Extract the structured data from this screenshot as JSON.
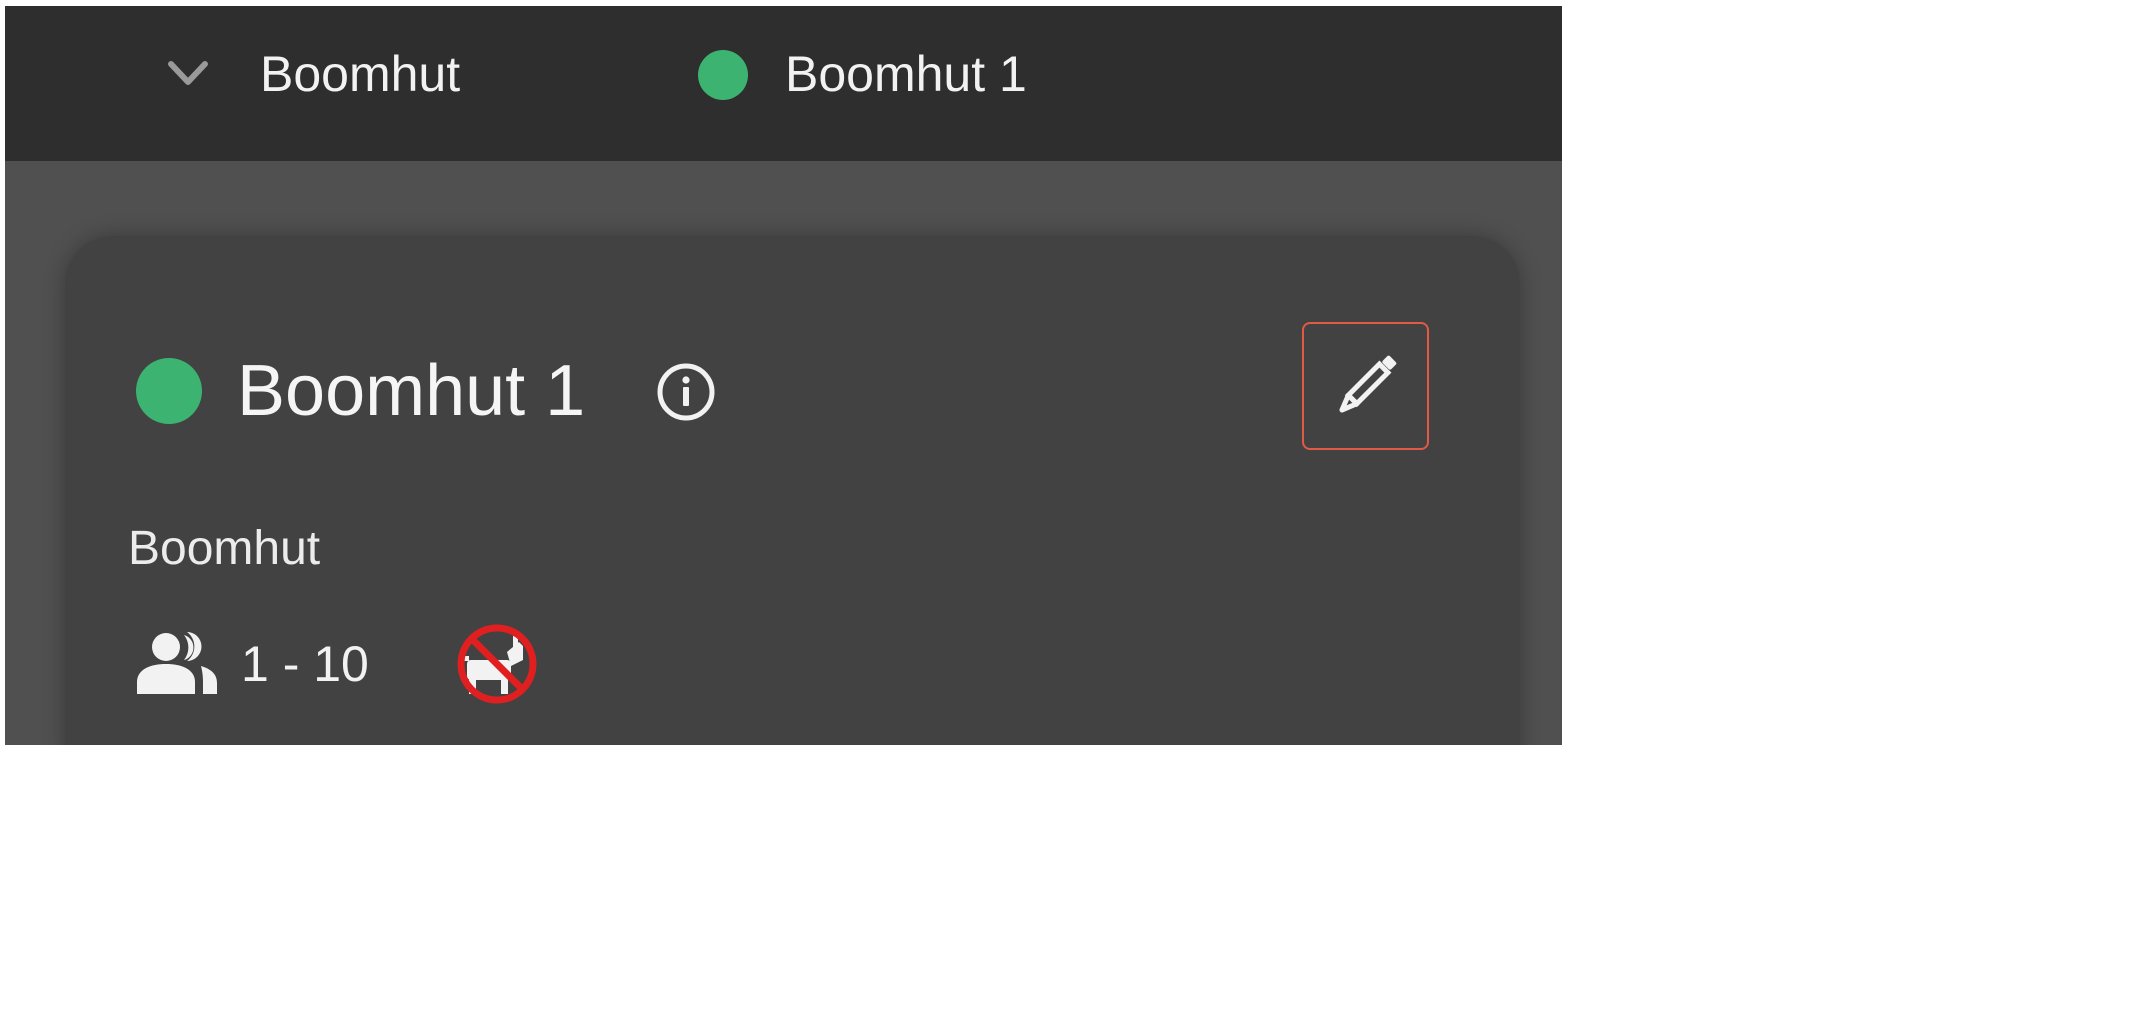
{
  "breadcrumb": {
    "parent_label": "Boomhut",
    "current_label": "Boomhut 1",
    "status_color": "#3cb371"
  },
  "card": {
    "title": "Boomhut 1",
    "status_color": "#3cb371",
    "type_label": "Boomhut",
    "capacity": "1 - 10",
    "icons": {
      "info": "info-circle-icon",
      "edit": "pencil-icon",
      "people": "people-icon",
      "no_pets": "no-pets-icon"
    },
    "accent_colors": {
      "edit_border": "#e05a45",
      "no_pets": "#e02020"
    }
  }
}
